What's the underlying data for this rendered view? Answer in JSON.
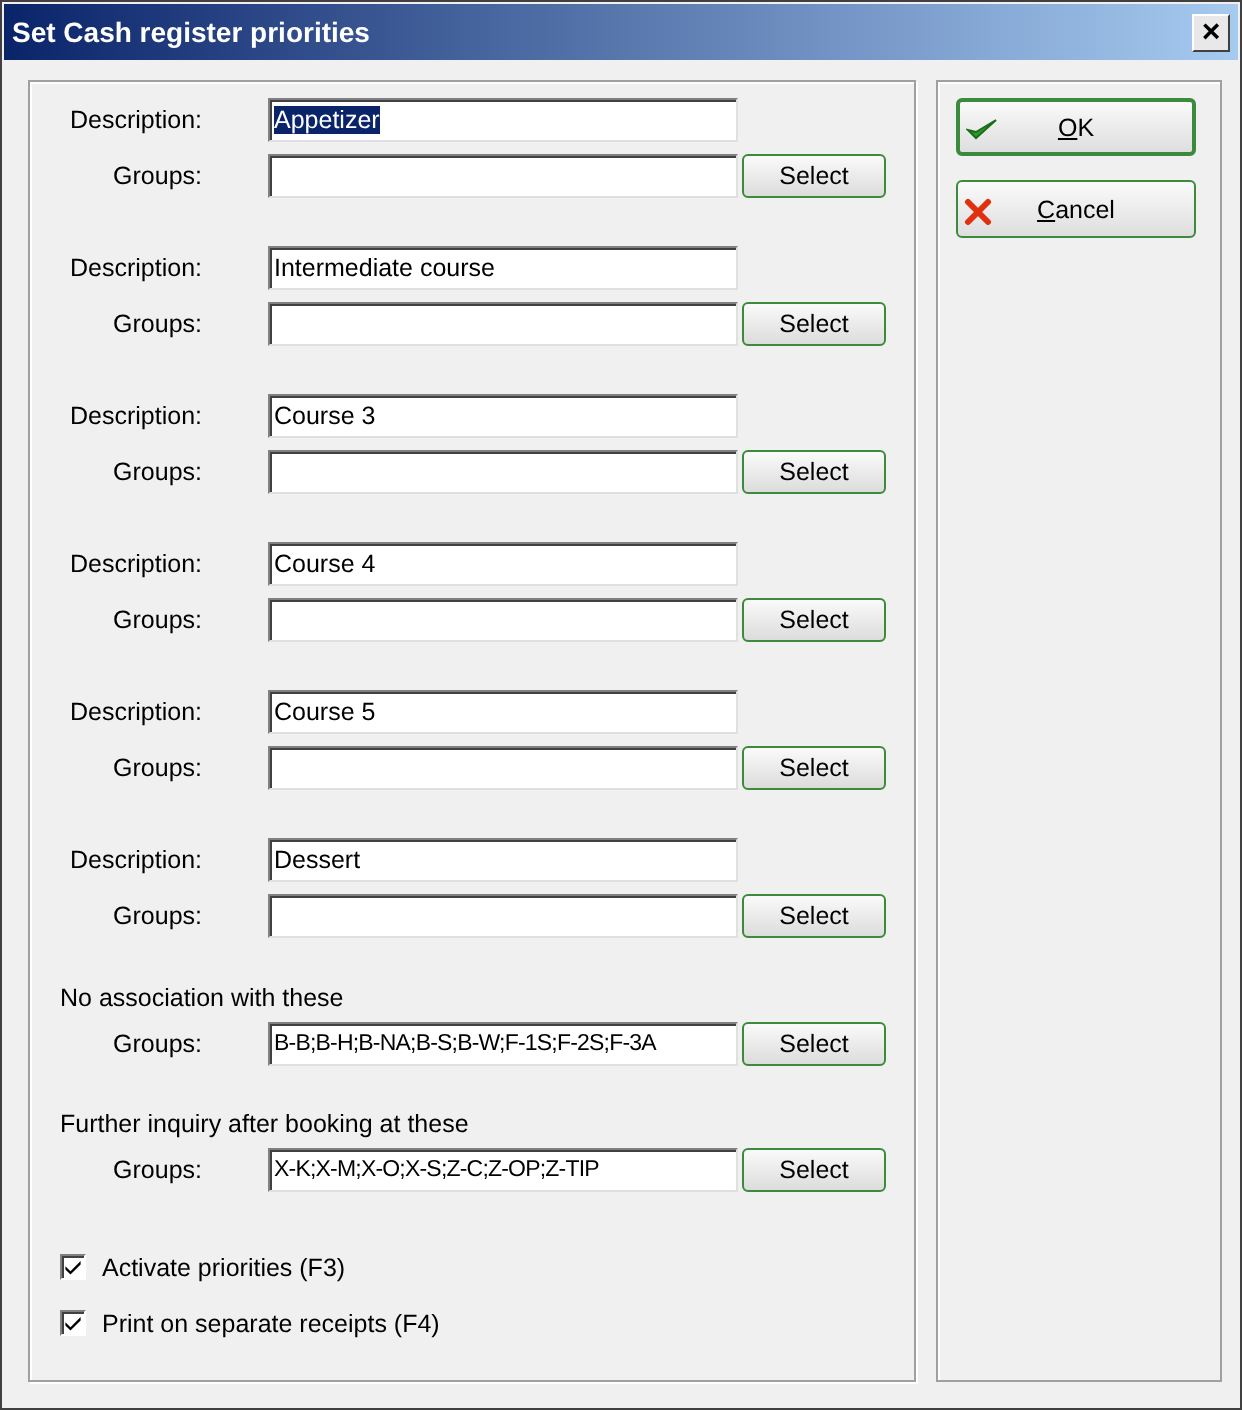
{
  "window": {
    "title": "Set Cash register priorities",
    "close": "×"
  },
  "sections": [
    {
      "kind": "description",
      "label": "Description:",
      "value": "Appetizer",
      "value_selected": true,
      "groups_label": "Groups:",
      "button": "Select"
    },
    {
      "kind": "description",
      "label": "Description:",
      "value": "Intermediate course",
      "value_selected": false,
      "groups_label": "Groups:",
      "button": "Select"
    },
    {
      "kind": "description",
      "label": "Description:",
      "value": "Course 3",
      "value_selected": false,
      "groups_label": "Groups:",
      "button": "Select"
    },
    {
      "kind": "description",
      "label": "Description:",
      "value": "Course 4",
      "value_selected": false,
      "groups_label": "Groups:",
      "button": "Select"
    },
    {
      "kind": "description",
      "label": "Description:",
      "value": "Course 5",
      "value_selected": false,
      "groups_label": "Groups:",
      "button": "Select"
    },
    {
      "kind": "description",
      "label": "Description:",
      "value": "Dessert",
      "value_selected": false,
      "groups_label": "Groups:",
      "button": "Select"
    },
    {
      "kind": "heading",
      "heading": "No association with these",
      "groups_label": "Groups:",
      "groups_value": "B-B;B-H;B-NA;B-S;B-W;F-1S;F-2S;F-3A",
      "button": "Select"
    },
    {
      "kind": "heading",
      "heading": "Further inquiry after booking at these",
      "groups_label": "Groups:",
      "groups_value": "X-K;X-M;X-O;X-S;Z-C;Z-OP;Z-TIP",
      "button": "Select"
    }
  ],
  "checkboxes": [
    {
      "label": "Activate priorities (F3)",
      "checked": true
    },
    {
      "label": "Print on separate receipts (F4)",
      "checked": true
    }
  ],
  "buttons": [
    {
      "kind": "ok",
      "mnemonic": "O",
      "rest": "K",
      "default": true
    },
    {
      "kind": "cancel",
      "mnemonic": "C",
      "rest": "ancel",
      "default": false
    }
  ]
}
